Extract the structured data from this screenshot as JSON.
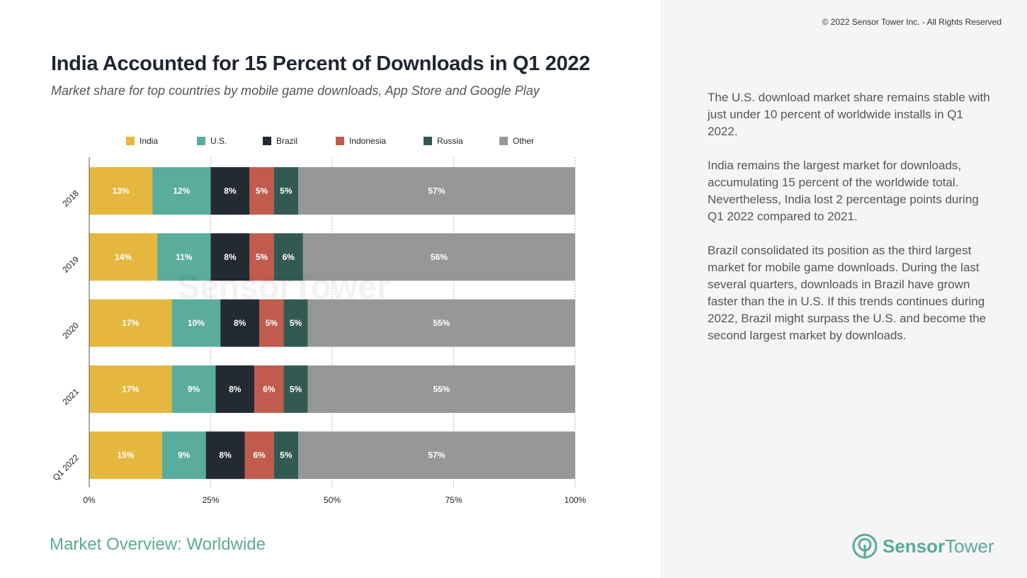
{
  "header": {
    "title": "India Accounted for 15 Percent of Downloads in Q1 2022",
    "subtitle": "Market share for top countries by mobile game downloads, App Store and Google Play"
  },
  "copyright": "© 2022 Sensor Tower Inc. - All Rights Reserved",
  "insights": [
    "The U.S. download market share remains stable with just under 10 percent of worldwide installs in Q1 2022.",
    "India remains the largest market for downloads, accumulating 15 percent of the worldwide total. Nevertheless, India lost 2 percentage points during Q1 2022 compared to 2021.",
    "Brazil consolidated its position as the third largest market for mobile game downloads. During the last several quarters, downloads in Brazil have grown faster than the in U.S. If this trends continues during 2022, Brazil might surpass the U.S. and become the second largest market by downloads."
  ],
  "footer": {
    "section_label": "Market Overview: Worldwide",
    "logo_bold": "Sensor",
    "logo_light": "Tower",
    "logo_icon": "sensor-tower-logo-icon"
  },
  "watermark": "SensorTower",
  "chart_data": {
    "type": "bar",
    "orientation": "horizontal",
    "stacked": true,
    "title": "India Accounted for 15 Percent of Downloads in Q1 2022",
    "subtitle": "Market share for top countries by mobile game downloads, App Store and Google Play",
    "categories": [
      "2018",
      "2019",
      "2020",
      "2021",
      "Q1 2022"
    ],
    "series": [
      {
        "name": "India",
        "color": "#e5b73f",
        "values": [
          13,
          14,
          17,
          17,
          15
        ]
      },
      {
        "name": "U.S.",
        "color": "#5aac9c",
        "values": [
          12,
          11,
          10,
          9,
          9
        ]
      },
      {
        "name": "Brazil",
        "color": "#232a31",
        "values": [
          8,
          8,
          8,
          8,
          8
        ]
      },
      {
        "name": "Indonesia",
        "color": "#c05b4d",
        "values": [
          5,
          5,
          5,
          6,
          6
        ]
      },
      {
        "name": "Russia",
        "color": "#335a52",
        "values": [
          5,
          6,
          5,
          5,
          5
        ]
      },
      {
        "name": "Other",
        "color": "#979797",
        "values": [
          57,
          56,
          55,
          55,
          57
        ]
      }
    ],
    "xlabel": "",
    "ylabel": "",
    "xlim": [
      0,
      100
    ],
    "xticks": [
      "0%",
      "25%",
      "50%",
      "75%",
      "100%"
    ],
    "xtick_values": [
      0,
      25,
      50,
      75,
      100
    ],
    "grid": "vertical dotted",
    "legend_position": "top",
    "data_labels": true
  }
}
